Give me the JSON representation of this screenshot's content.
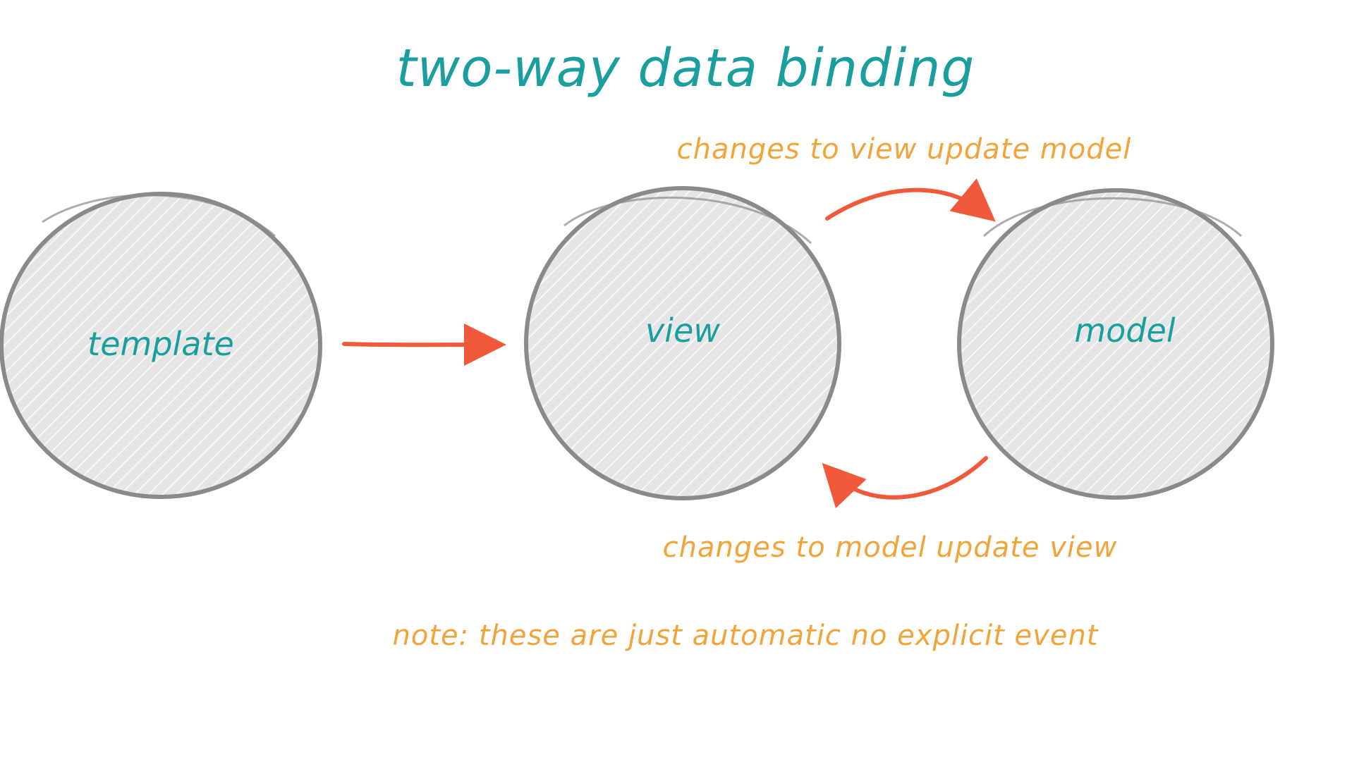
{
  "diagram": {
    "title": "two-way data binding",
    "nodes": {
      "template": "template",
      "view": "view",
      "model": "model"
    },
    "annotations": {
      "view_to_model": "changes to view update model",
      "model_to_view": "changes to model update view",
      "note": "note: these are just automatic no explicit event"
    }
  },
  "colors": {
    "title": "#1a9e9e",
    "node_label": "#1a9e9e",
    "annotation": "#f0a43a",
    "arrow": "#f05a3a",
    "circle_stroke": "#8a8a8a",
    "circle_fill": "#e6e6e6",
    "hatch": "#f7f7f7"
  }
}
